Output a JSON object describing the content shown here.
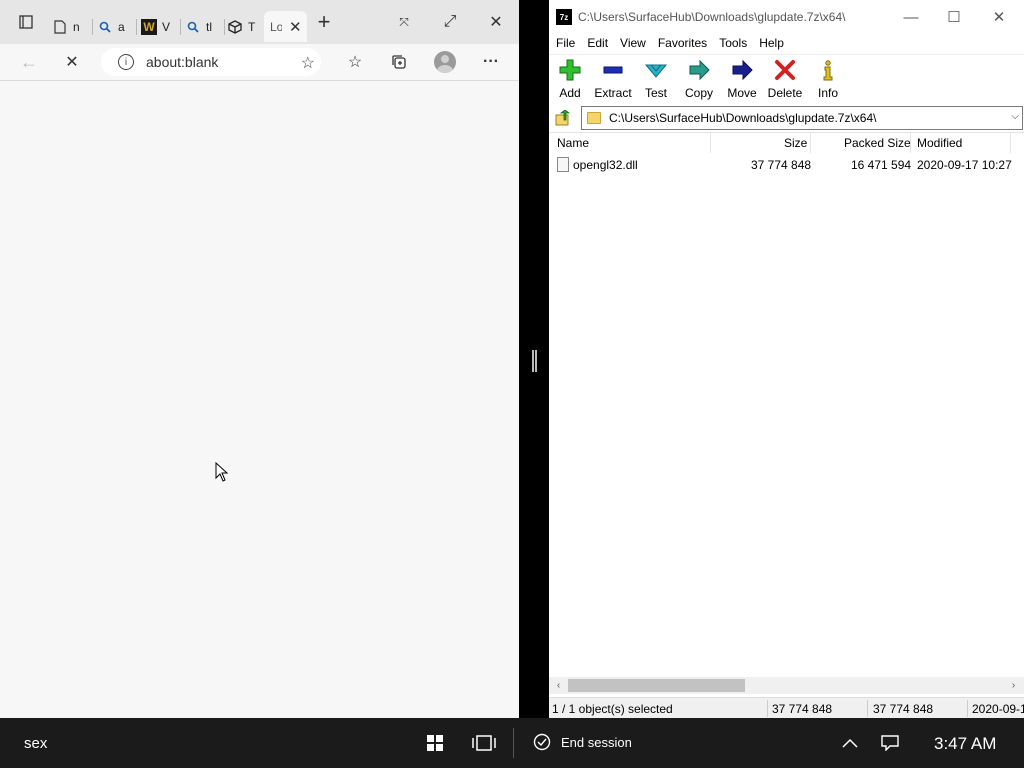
{
  "browser": {
    "tabs": [
      {
        "icon": "page-icon",
        "label": "n"
      },
      {
        "icon": "search-icon",
        "label": "a"
      },
      {
        "icon": "w-logo-icon",
        "label": "V"
      },
      {
        "icon": "search-icon",
        "label": "tl"
      },
      {
        "icon": "box-icon",
        "label": "T"
      },
      {
        "icon": "none",
        "label": "Lo"
      }
    ],
    "address": "about:blank"
  },
  "sevenzip": {
    "app_icon": "7z",
    "title": "C:\\Users\\SurfaceHub\\Downloads\\glupdate.7z\\x64\\",
    "menu": [
      "File",
      "Edit",
      "View",
      "Favorites",
      "Tools",
      "Help"
    ],
    "toolbar": [
      {
        "label": "Add",
        "icon": "plus-icon"
      },
      {
        "label": "Extract",
        "icon": "minus-icon"
      },
      {
        "label": "Test",
        "icon": "check-icon"
      },
      {
        "label": "Copy",
        "icon": "copy-arrow-icon"
      },
      {
        "label": "Move",
        "icon": "move-arrow-icon"
      },
      {
        "label": "Delete",
        "icon": "delete-x-icon"
      },
      {
        "label": "Info",
        "icon": "info-icon"
      }
    ],
    "path": "C:\\Users\\SurfaceHub\\Downloads\\glupdate.7z\\x64\\",
    "columns": {
      "name": "Name",
      "size": "Size",
      "packed": "Packed Size",
      "modified": "Modified"
    },
    "files": [
      {
        "name": "opengl32.dll",
        "size": "37 774 848",
        "packed": "16 471 594",
        "modified": "2020-09-17 10:27"
      }
    ],
    "status": {
      "selected": "1 / 1 object(s) selected",
      "size": "37 774 848",
      "packed": "37 774 848",
      "date": "2020-09-1"
    }
  },
  "taskbar": {
    "label": "sex",
    "end_session": "End session",
    "clock": "3:47 AM"
  }
}
